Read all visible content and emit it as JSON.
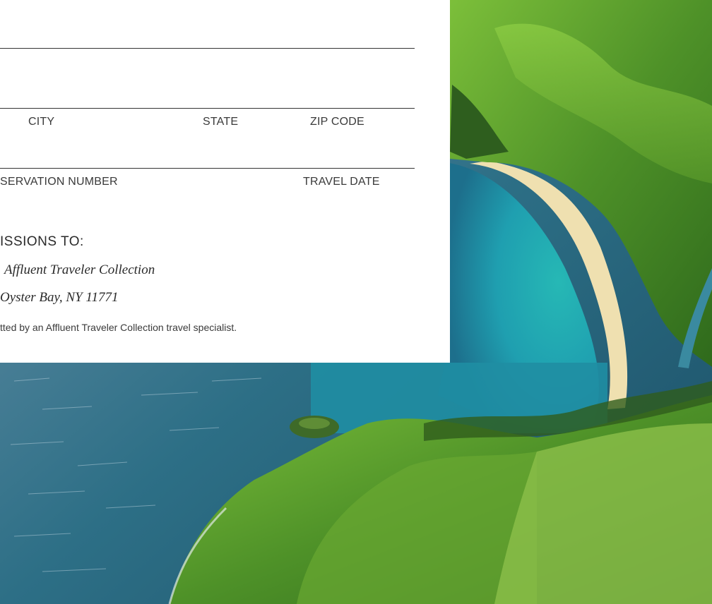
{
  "form": {
    "labels": {
      "city": "CITY",
      "state": "STATE",
      "zip": "ZIP CODE",
      "reservation": "SERVATION NUMBER",
      "travel_date": "TRAVEL DATE"
    },
    "submit_heading": "ISSIONS TO:",
    "collection_name": "Affluent Traveler Collection",
    "address": "Oyster Bay, NY 11771",
    "note": "tted by an Affluent Traveler Collection travel specialist."
  },
  "photo": {
    "subject": "aerial-coastline-photo",
    "colors": {
      "sea": "#2f7a8c",
      "lagoon": "#25b5b8",
      "sand": "#efe0b0",
      "hills": "#5c9e2a"
    }
  }
}
